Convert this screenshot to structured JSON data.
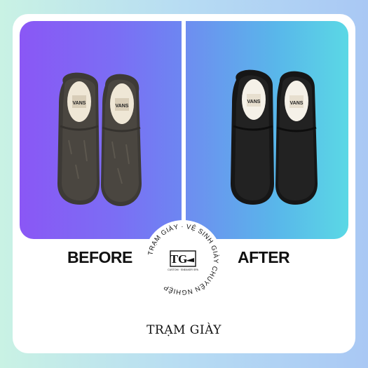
{
  "labels": {
    "before": "BEFORE",
    "after": "AFTER"
  },
  "logo": {
    "ring_text": "TRẠM GIÀY · VỆ SINH GIÀY CHUYÊN NGHIỆP",
    "monogram": "TG",
    "tagline": "CUSTOM · SNEAKER SPA"
  },
  "shoe_tongue_text": "VANS",
  "footer": {
    "brand": "TRẠM GIÀY"
  },
  "colors": {
    "before_gradient": [
      "#8a57f5",
      "#6d86f2"
    ],
    "after_gradient": [
      "#6e8df0",
      "#5ad8e5"
    ]
  }
}
